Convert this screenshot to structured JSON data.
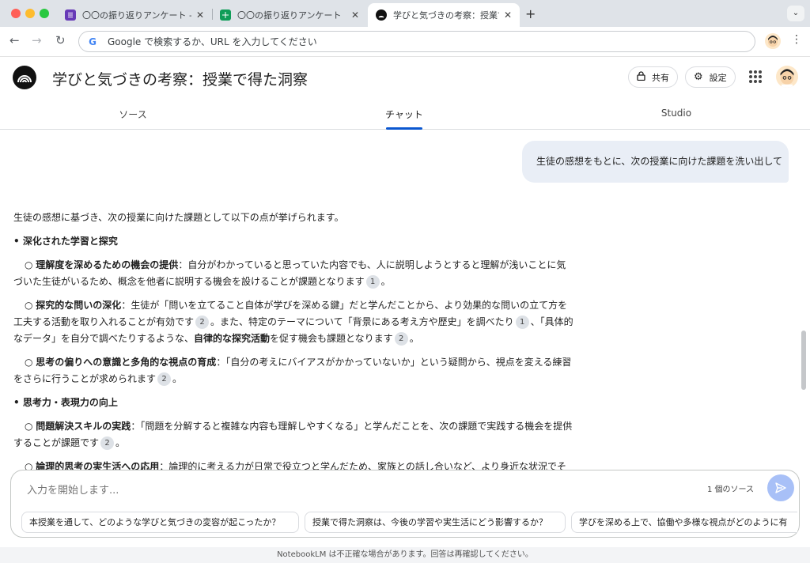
{
  "browser": {
    "tabs": [
      {
        "title": "〇〇の振り返りアンケート - Goo",
        "icon": "google-forms-icon",
        "color": "#673ab7"
      },
      {
        "title": "〇〇の振り返りアンケート（回答",
        "icon": "google-sheets-icon",
        "color": "#0f9d58"
      },
      {
        "title": "学びと気づきの考察：授業で得た",
        "icon": "notebooklm-icon",
        "color": "#111111"
      }
    ],
    "omnibox_placeholder": "Google で検索するか、URL を入力してください"
  },
  "app": {
    "title": "学びと気づきの考察：授業で得た洞察",
    "share_label": "共有",
    "settings_label": "設定"
  },
  "nav_tabs": [
    {
      "label": "ソース"
    },
    {
      "label": "チャット",
      "active": true
    },
    {
      "label": "Studio"
    }
  ],
  "chat": {
    "user_message": "生徒の感想をもとに、次の授業に向けた課題を洗い出して",
    "answer": {
      "intro": "生徒の感想に基づき、次の授業に向けた課題として以下の点が挙げられます。",
      "s1_heading": "• 深化された学習と探究",
      "s1_i1_bold": "理解度を深めるための機会の提供",
      "s1_i1_text": "：自分がわかっていると思っていた内容でも、人に説明しようとすると理解が浅いことに気づいた生徒がいるため、概念を他者に説明する機会を設けることが課題となります",
      "s1_i1_cite": "1",
      "s1_i2_bold": "探究的な問いの深化",
      "s1_i2_text_a": "：生徒が「問いを立てること自体が学びを深める鍵」だと学んだことから、より効果的な問いの立て方を工夫する活動を取り入れることが有効です",
      "s1_i2_cite_a": "2",
      "s1_i2_text_b": "。また、特定のテーマについて「背景にある考え方や歴史」を調べたり",
      "s1_i2_cite_b": "1",
      "s1_i2_text_c": "、「具体的なデータ」を自分で調べたりするような、",
      "s1_i2_bold2": "自律的な探究活動",
      "s1_i2_text_d": "を促す機会も課題となります",
      "s1_i2_cite_c": "2",
      "s1_i3_bold": "思考の偏りへの意識と多角的な視点の育成",
      "s1_i3_text": "：「自分の考えにバイアスがかかっていないか」という疑問から、視点を変える練習をさらに行うことが求められます",
      "s1_i3_cite": "2",
      "s2_heading": "• 思考力・表現力の向上",
      "s2_i1_bold": "問題解決スキルの実践",
      "s2_i1_text": "：「問題を分解すると複雑な内容も理解しやすくなる」と学んだことを、次の課題で実践する機会を提供することが課題です",
      "s2_i1_cite": "2",
      "s2_i2_bold": "論理的思考の実生活への応用",
      "s2_i2_text": "：論理的に考える力が日常で役立つと学んだため、家族との話し合いなど、より身近な状況でその力を"
    }
  },
  "composer": {
    "placeholder": "入力を開始します...",
    "source_count": "1 個のソース",
    "suggestions": [
      "本授業を通して、どのような学びと気づきの変容が起こったか？",
      "授業で得た洞察は、今後の学習や実生活にどう影響するか？",
      "学びを深める上で、協働や多様な視点がどのように有"
    ]
  },
  "footer": {
    "disclaimer": "NotebookLM は不正確な場合があります。回答は再確認してください。"
  }
}
